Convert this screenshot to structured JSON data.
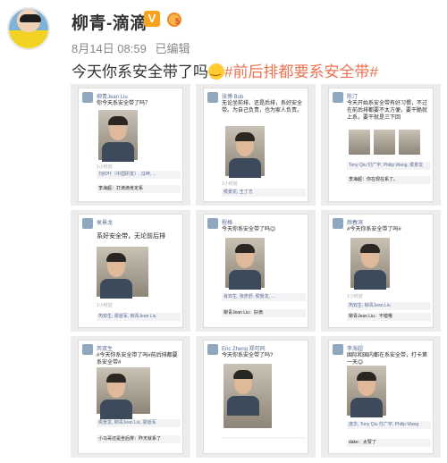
{
  "post": {
    "username": "柳青-滴滴",
    "verified_badge": "V",
    "medal_number": "5",
    "date": "8月14日 08:59",
    "edited": "已编辑",
    "text_main": "今天你系安全带了吗",
    "hashtag": "#前后排都要系安全带#"
  },
  "cards": [
    {
      "name": "柳青Jean Liu",
      "text": "你今天系安全带了吗？",
      "time": "1小时前",
      "likes": "刘红叶（中国研发）, 冯坤, ...",
      "comment": "李海超：打滴滴肯定系"
    },
    {
      "name": "张博 Bob",
      "text": "无论坐前排、还是后排，系好安全带。为自己负责，也为家人负责。",
      "time": "1小时前",
      "likes": "侯景龙, 王丁方",
      "comment": ""
    },
    {
      "name": "陈汀",
      "text": "今天开始系安全带有好习惯，不过在前后排都要不太方便，要干脆就上系，要干就是三下回",
      "time": "",
      "likes": "Tony Qiu 付广宇, Philip Wang, 侯景龙",
      "comment": "李海超：你在现在系了。"
    },
    {
      "name": "侯景龙",
      "text": "系好安全带，无论前后排",
      "time": "1小时前",
      "likes": "芮双生, 梁道军, 柳青Jean Liu",
      "comment": ""
    },
    {
      "name": "程格",
      "text": "今天你系安全带了吗😊",
      "time": "",
      "likes": "肖双生, 张彦舒, 侯景龙, ...",
      "comment": "柳青Jean Liu：好滴"
    },
    {
      "name": "颜春滨",
      "text": "#今天你系安全带了吗#",
      "time": "1小时前",
      "likes": "芮双生, 柳青Jean Liu",
      "comment": "柳青Jean Liu：不错哦"
    },
    {
      "name": "芮双生",
      "text": "#今天你系安全带了吗#前后排都要系安全带#",
      "time": "",
      "likes": "侯景龙, 柳青Jean Liu, 梁道军",
      "comment": "小马哥还是坐后排：昨天就系了"
    },
    {
      "name": "Eric Zheng 郑可同",
      "text": "今天你系安全带了吗?",
      "time": "",
      "likes": "",
      "comment": ""
    },
    {
      "name": "李海超",
      "text": "国际和国内都在系安全带，打卡第一天😊",
      "time": "",
      "likes": "庞华, Tony Qiu 付广宇, Philip Wang",
      "comment": "dake：太赞了"
    }
  ]
}
